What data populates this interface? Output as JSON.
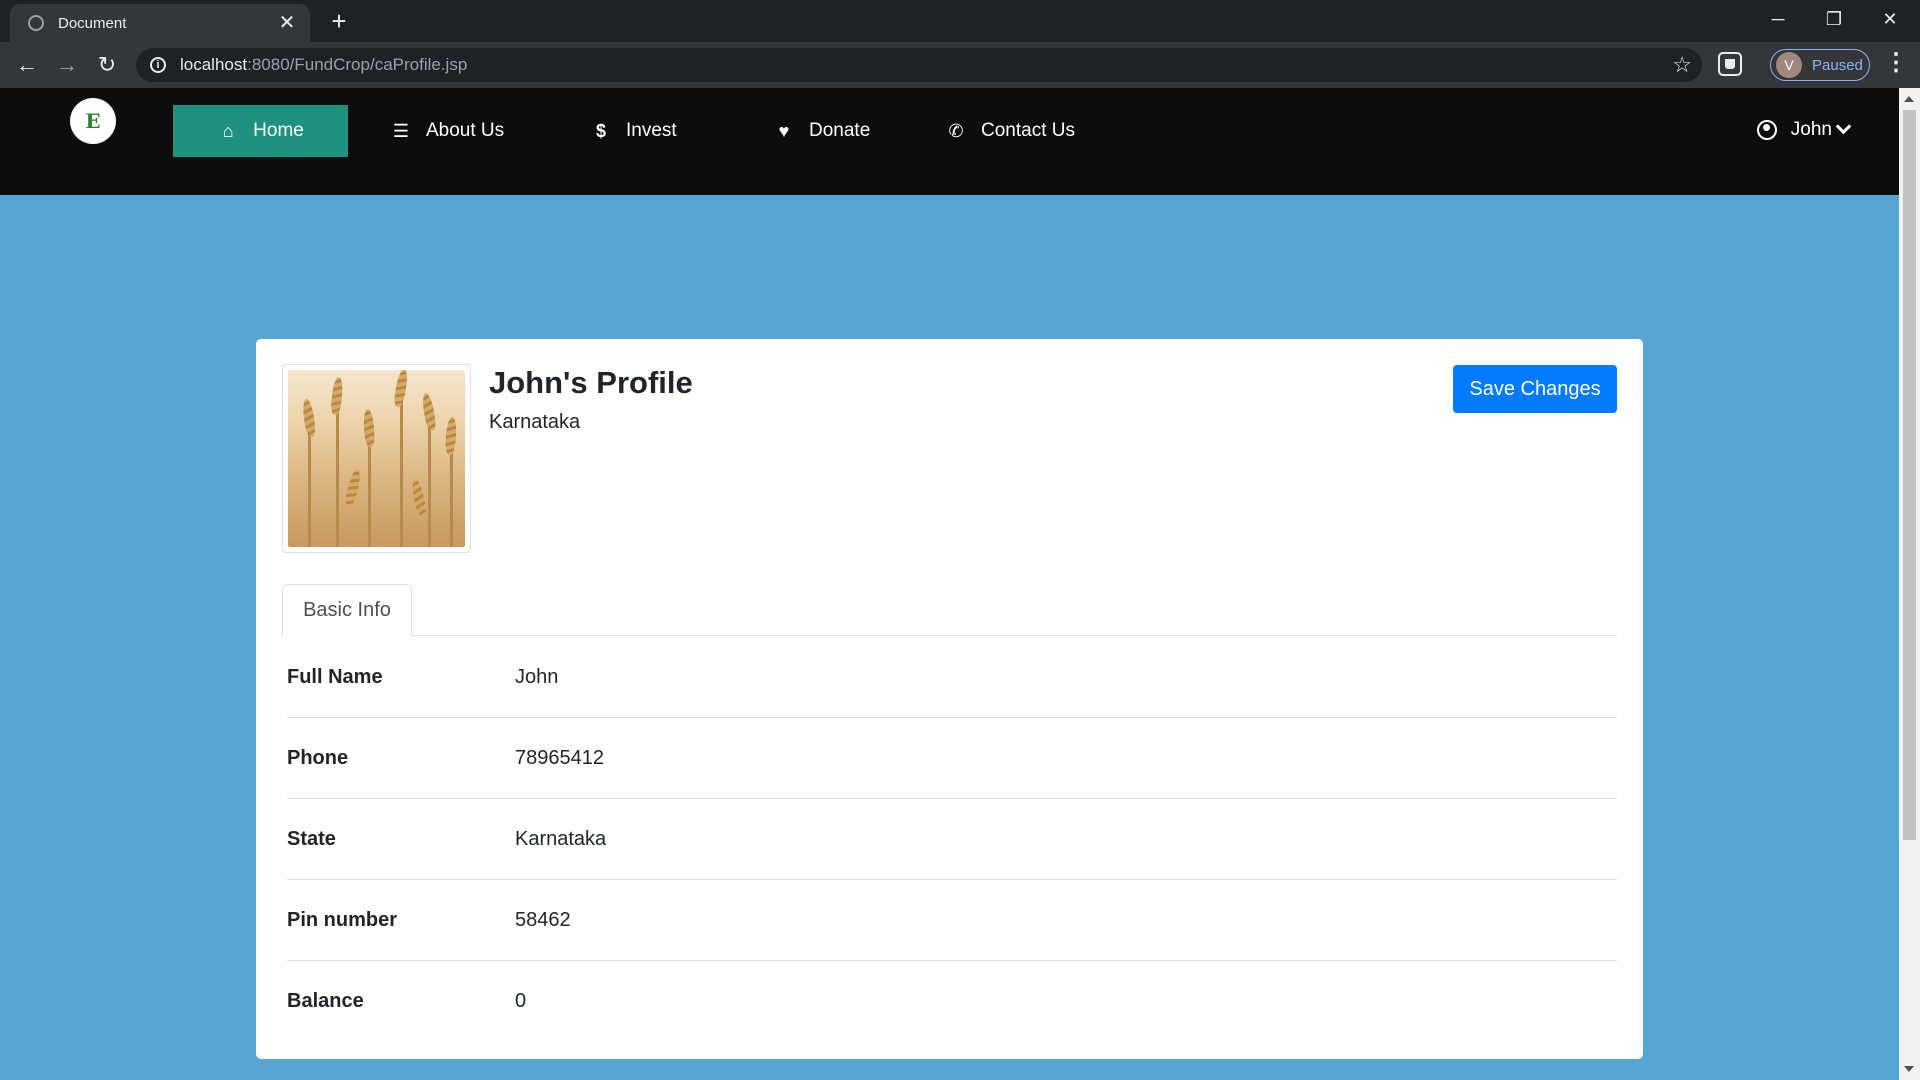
{
  "browser": {
    "tab_title": "Document",
    "url_host": "localhost",
    "url_path": ":8080/FundCrop/caProfile.jsp",
    "profile_initial": "V",
    "profile_status": "Paused"
  },
  "nav": {
    "logo_letter": "E",
    "items": [
      {
        "label": "Home",
        "icon": "home-icon"
      },
      {
        "label": "About Us",
        "icon": "list-icon"
      },
      {
        "label": "Invest",
        "icon": "dollar-icon"
      },
      {
        "label": "Donate",
        "icon": "heart-icon"
      },
      {
        "label": "Contact Us",
        "icon": "phone-icon"
      }
    ],
    "user": "John"
  },
  "profile": {
    "title": "John's Profile",
    "subtitle": "Karnataka",
    "save_label": "Save Changes",
    "tab_label": "Basic Info",
    "rows": [
      {
        "label": "Full Name",
        "value": "John"
      },
      {
        "label": "Phone",
        "value": "78965412"
      },
      {
        "label": "State",
        "value": "Karnataka"
      },
      {
        "label": "Pin number",
        "value": "58462"
      },
      {
        "label": "Balance",
        "value": "0"
      }
    ]
  },
  "colors": {
    "page_background": "#55a7d1",
    "nav_background": "#0d0d0d",
    "nav_active": "#1f9180",
    "primary_button": "#007bff"
  }
}
